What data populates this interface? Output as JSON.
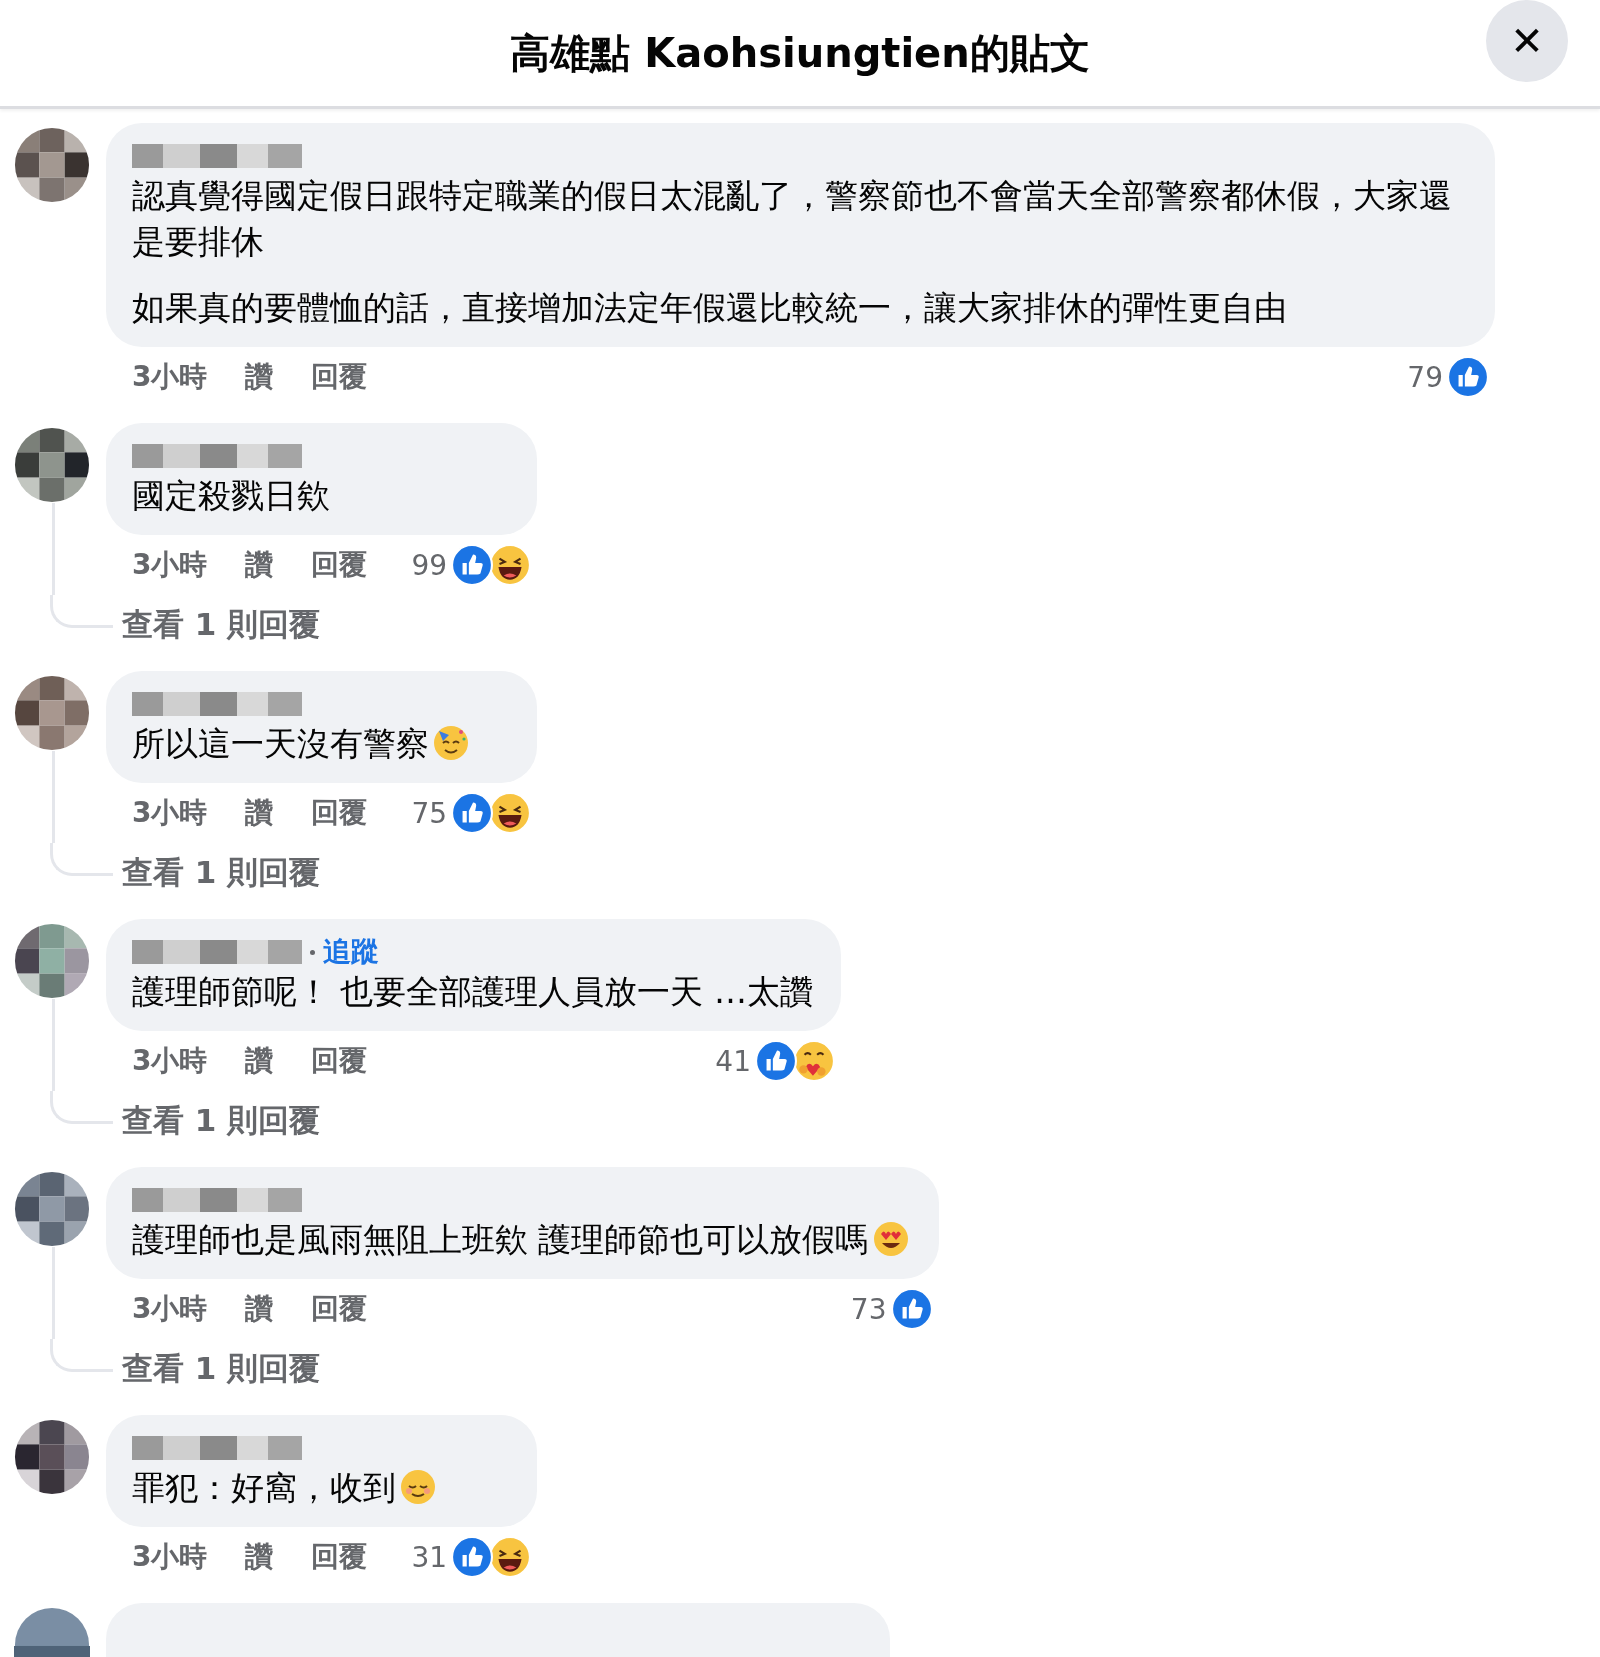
{
  "header": {
    "title": "高雄點 Kaohsiungtien的貼文",
    "close_label": "✕"
  },
  "comments": [
    {
      "paragraphs": [
        "認真覺得國定假日跟特定職業的假日太混亂了，警察節也不會當天全部警察都休假，大家還是要排休",
        "如果真的要體恤的話，直接增加法定年假還比較統一，讓大家排休的彈性更自由"
      ],
      "time": "3小時",
      "like_label": "讚",
      "reply_label": "回覆",
      "reaction_count": "79",
      "reactions": [
        {
          "kind": "like"
        }
      ]
    },
    {
      "paragraphs": [
        "國定殺戮日欸"
      ],
      "time": "3小時",
      "like_label": "讚",
      "reply_label": "回覆",
      "reaction_count": "99",
      "reactions": [
        {
          "kind": "like"
        },
        {
          "kind": "haha"
        }
      ],
      "view_replies": "查看 1 則回覆"
    },
    {
      "paragraphs": [
        "所以這一天沒有警察"
      ],
      "trailing_emoji": {
        "kind": "party"
      },
      "time": "3小時",
      "like_label": "讚",
      "reply_label": "回覆",
      "reaction_count": "75",
      "reactions": [
        {
          "kind": "like"
        },
        {
          "kind": "haha"
        }
      ],
      "view_replies": "查看 1 則回覆"
    },
    {
      "follow_label": "追蹤",
      "paragraphs": [
        "護理師節呢！ 也要全部護理人員放一天 …太讚"
      ],
      "time": "3小時",
      "like_label": "讚",
      "reply_label": "回覆",
      "reaction_count": "41",
      "reactions": [
        {
          "kind": "like"
        },
        {
          "kind": "care"
        }
      ],
      "view_replies": "查看 1 則回覆"
    },
    {
      "paragraphs": [
        "護理師也是風雨無阻上班欸 護理師節也可以放假嗎"
      ],
      "trailing_emoji": {
        "kind": "heart_eyes"
      },
      "time": "3小時",
      "like_label": "讚",
      "reply_label": "回覆",
      "reaction_count": "73",
      "reactions": [
        {
          "kind": "like"
        }
      ],
      "view_replies": "查看 1 則回覆"
    },
    {
      "paragraphs": [
        "罪犯：好窩，收到"
      ],
      "trailing_emoji": {
        "kind": "relieved"
      },
      "time": "3小時",
      "like_label": "讚",
      "reply_label": "回覆",
      "reaction_count": "31",
      "reactions": [
        {
          "kind": "like"
        },
        {
          "kind": "haha"
        }
      ]
    }
  ],
  "next_comment_partial": true
}
